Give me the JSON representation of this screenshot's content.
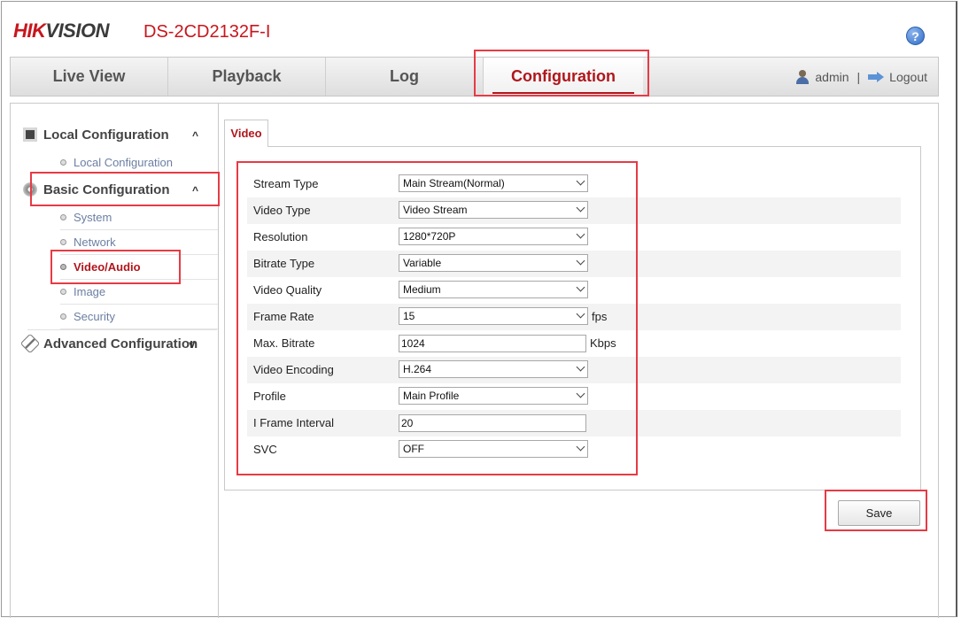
{
  "header": {
    "brand_part1": "HIK",
    "brand_part2": "VISION",
    "model": "DS-2CD2132F-I",
    "help_symbol": "?"
  },
  "nav": {
    "tabs": [
      {
        "label": "Live View"
      },
      {
        "label": "Playback"
      },
      {
        "label": "Log"
      },
      {
        "label": "Configuration",
        "active": true
      }
    ],
    "user": "admin",
    "separator": "|",
    "logout": "Logout"
  },
  "sidebar": {
    "sections": [
      {
        "label": "Local Configuration",
        "icon": "monitor-icon",
        "caret": "^",
        "items": [
          "Local Configuration"
        ]
      },
      {
        "label": "Basic Configuration",
        "icon": "gear-icon",
        "caret": "^",
        "items": [
          "System",
          "Network",
          "Video/Audio",
          "Image",
          "Security"
        ],
        "active_item": "Video/Audio"
      },
      {
        "label": "Advanced Configuration",
        "icon": "wrench-icon",
        "caret": "v"
      }
    ]
  },
  "main": {
    "tab": "Video",
    "fields": [
      {
        "label": "Stream Type",
        "value": "Main Stream(Normal)",
        "kind": "select"
      },
      {
        "label": "Video Type",
        "value": "Video Stream",
        "kind": "select"
      },
      {
        "label": "Resolution",
        "value": "1280*720P",
        "kind": "select"
      },
      {
        "label": "Bitrate Type",
        "value": "Variable",
        "kind": "select"
      },
      {
        "label": "Video Quality",
        "value": "Medium",
        "kind": "select"
      },
      {
        "label": "Frame Rate",
        "value": "15",
        "kind": "select",
        "unit": "fps"
      },
      {
        "label": "Max. Bitrate",
        "value": "1024",
        "kind": "input",
        "unit": "Kbps"
      },
      {
        "label": "Video Encoding",
        "value": "H.264",
        "kind": "select"
      },
      {
        "label": "Profile",
        "value": "Main Profile",
        "kind": "select"
      },
      {
        "label": "I Frame Interval",
        "value": "20",
        "kind": "input"
      },
      {
        "label": "SVC",
        "value": "OFF",
        "kind": "select"
      }
    ],
    "save_label": "Save"
  },
  "colors": {
    "brand_red": "#c8161d",
    "highlight_red": "#e63b45",
    "link_blue": "#6b7fa3"
  }
}
